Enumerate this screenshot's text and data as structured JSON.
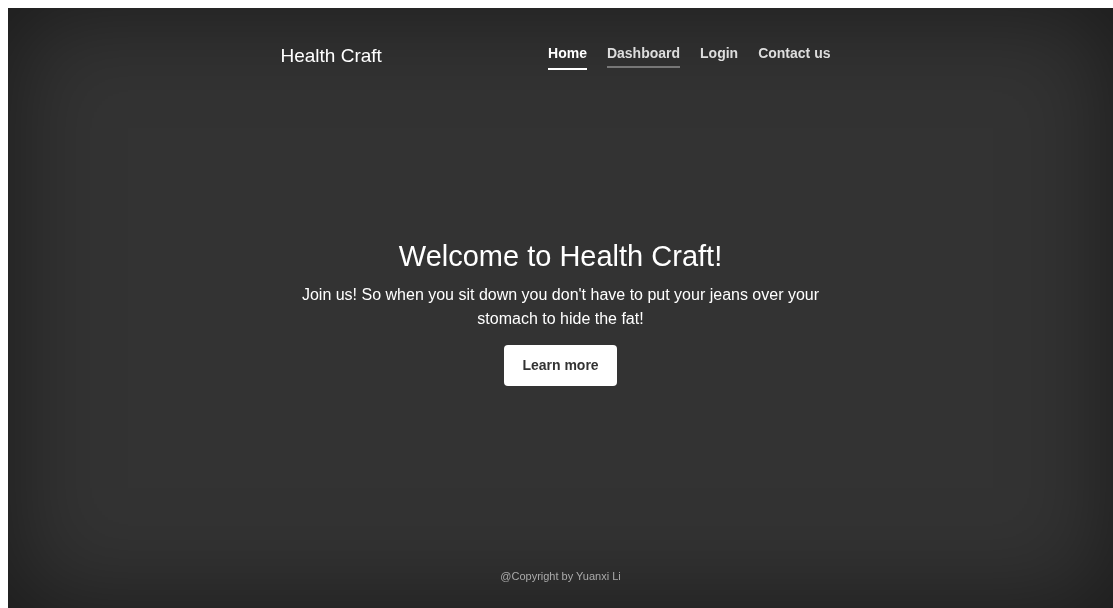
{
  "brand": "Health Craft",
  "nav": [
    {
      "label": "Home",
      "selected": true,
      "hovered": false
    },
    {
      "label": "Dashboard",
      "selected": false,
      "hovered": true
    },
    {
      "label": "Login",
      "selected": false,
      "hovered": false
    },
    {
      "label": "Contact us",
      "selected": false,
      "hovered": false
    }
  ],
  "hero": {
    "title": "Welcome to Health Craft!",
    "text": "Join us! So when you sit down you don't have to put your jeans over your stomach to hide the fat!",
    "button": "Learn more"
  },
  "footer": "@Copyright by Yuanxi Li"
}
